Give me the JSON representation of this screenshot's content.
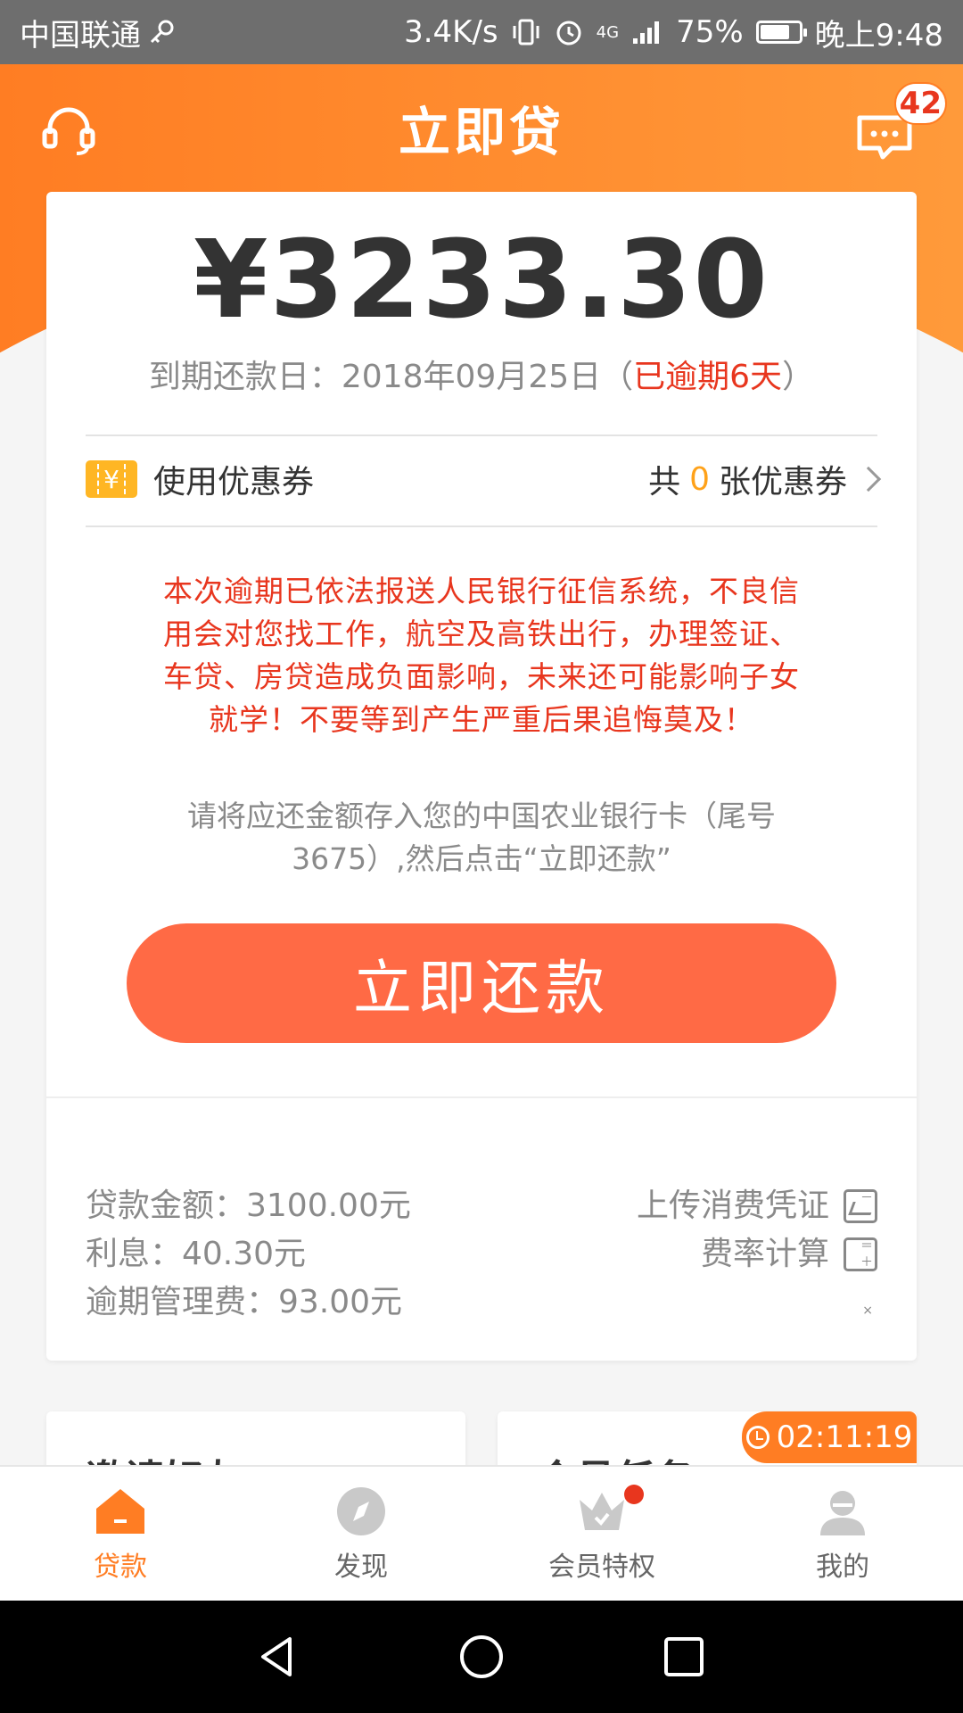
{
  "status_bar": {
    "carrier": "中国联通",
    "speed": "3.4K/s",
    "network": "4G",
    "battery": "75%",
    "time": "晚上9:48"
  },
  "header": {
    "title": "立即贷",
    "message_badge": "42"
  },
  "loan": {
    "amount": "¥3233.30",
    "due_prefix": "到期还款日：2018年09月25日（",
    "overdue_text": "已逾期6天",
    "due_suffix": "）"
  },
  "coupon": {
    "label": "使用优惠券",
    "count_prefix": "共",
    "count": "0",
    "count_suffix": "张优惠券"
  },
  "warning_text": "本次逾期已依法报送人民银行征信系统，不良信用会对您找工作，航空及高铁出行，办理签证、车贷、房贷造成负面影响，未来还可能影响子女就学！不要等到产生严重后果追悔莫及！",
  "instruction_text": "请将应还金额存入您的中国农业银行卡（尾号3675）,然后点击“立即还款”",
  "repay_button": "立即还款",
  "details": {
    "loan_amount": "贷款金额：3100.00元",
    "interest": "利息：40.30元",
    "late_fee": "逾期管理费：93.00元",
    "upload_voucher": "上传消费凭证",
    "rate_calc": "费率计算"
  },
  "lower_cards": {
    "invite": "邀请好友",
    "member_task": "会员任务",
    "timer": "02:11:19"
  },
  "bottom_nav": [
    {
      "label": "贷款"
    },
    {
      "label": "发现"
    },
    {
      "label": "会员特权"
    },
    {
      "label": "我的"
    }
  ],
  "colors": {
    "brand_orange": "#ff7d23",
    "button_orange": "#ff6a45",
    "warning_red": "#e8361e",
    "coupon_yellow": "#ffb624"
  }
}
